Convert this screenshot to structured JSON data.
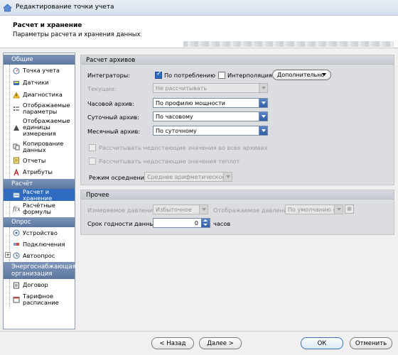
{
  "window": {
    "title": "Редактирование точки учета"
  },
  "header": {
    "title": "Расчет и хранение",
    "subtitle": "Параметры расчета и хранения данных"
  },
  "sidebar": {
    "groups": [
      {
        "label": "Общие",
        "items": [
          {
            "label": "Точка учета",
            "icon": "meter-icon"
          },
          {
            "label": "Датчики",
            "icon": "sensor-icon"
          },
          {
            "label": "Диагностика",
            "icon": "warning-icon"
          },
          {
            "label": "Отображаемые параметры",
            "icon": "list-icon"
          },
          {
            "label": "Отображаемые единицы измерения",
            "icon": "units-icon"
          },
          {
            "label": "Копирование данных",
            "icon": "copy-icon"
          },
          {
            "label": "Отчеты",
            "icon": "report-icon"
          },
          {
            "label": "Атрибуты",
            "icon": "attribute-icon"
          }
        ]
      },
      {
        "label": "Расчёт",
        "items": [
          {
            "label": "Расчет и хранение",
            "icon": "storage-icon"
          },
          {
            "label": "Расчётные формулы",
            "icon": "formula-icon"
          }
        ]
      },
      {
        "label": "Опрос",
        "items": [
          {
            "label": "Устройство",
            "icon": "device-icon"
          },
          {
            "label": "Подключения",
            "icon": "connection-icon"
          },
          {
            "label": "Автоопрос",
            "icon": "clock-icon"
          }
        ]
      },
      {
        "label": "Энергоснабжающая организация",
        "items": [
          {
            "label": "Договор",
            "icon": "contract-icon"
          },
          {
            "label": "Тарифное расписание",
            "icon": "schedule-icon"
          }
        ]
      }
    ]
  },
  "archives": {
    "title": "Расчет архивов",
    "integrators_label": "Интеграторы:",
    "on_demand_label": "По потреблению",
    "on_demand_checked": true,
    "interpolation_label": "Интерполяция",
    "interpolation_checked": false,
    "additional_label": "Дополнительно",
    "current_label": "Текущие:",
    "current_value": "Не рассчитывать",
    "hourly_label": "Часовой архив:",
    "hourly_value": "По профилю мощности",
    "daily_label": "Суточный архив:",
    "daily_value": "По часовому",
    "monthly_label": "Месячный архив:",
    "monthly_value": "По суточному",
    "missing_all_label": "Рассчитывать недостающие значения во всех архивах",
    "missing_heat_label": "Рассчитывать недостающие значения теплот",
    "averaging_label": "Режим осреднения:",
    "averaging_value": "Среднее арифметическое"
  },
  "other": {
    "title": "Прочее",
    "measured_pressure_label": "Измеряемое давление:",
    "measured_pressure_value": "Избыточное",
    "displayed_pressure_label": "Отображаемое давление:",
    "displayed_pressure_value": "По умолчанию (из ...",
    "shelf_life_label": "Срок годности данных:",
    "shelf_life_value": "0",
    "shelf_life_unit": "часов"
  },
  "footer": {
    "back": "< Назад",
    "next": "Далее >",
    "ok": "ОК",
    "cancel": "Отменить"
  }
}
